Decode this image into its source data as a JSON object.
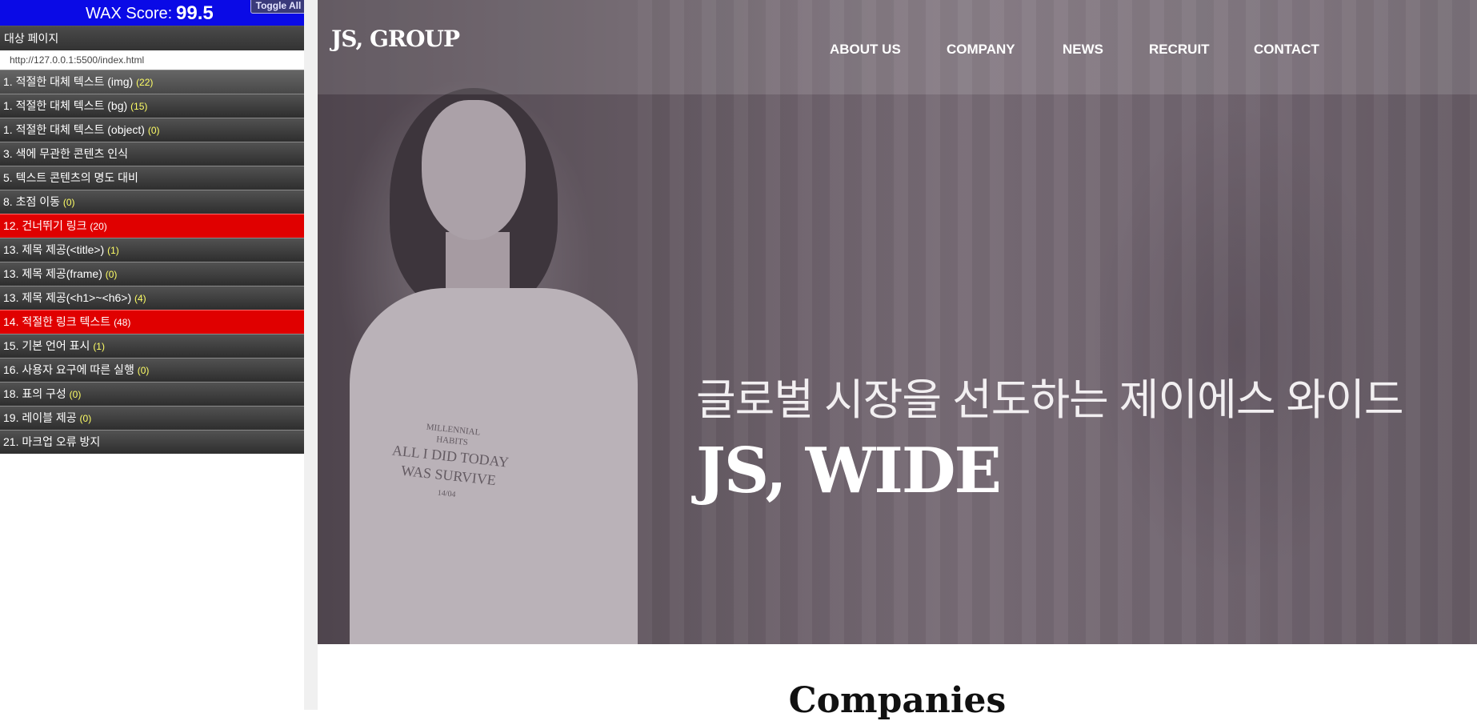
{
  "wax": {
    "score_label": "WAX Score:",
    "score_value": "99.5",
    "toggle_label": "Toggle All",
    "target_title": "대상 페이지",
    "target_url": "http://127.0.0.1:5500/index.html",
    "items": [
      {
        "label": "1. 적절한 대체 텍스트 (img)",
        "count": "(22)",
        "status": "normal"
      },
      {
        "label": "1. 적절한 대체 텍스트 (bg)",
        "count": "(15)",
        "status": "normal"
      },
      {
        "label": "1. 적절한 대체 텍스트 (object)",
        "count": "(0)",
        "status": "normal"
      },
      {
        "label": "3. 색에 무관한 콘텐츠 인식",
        "count": "",
        "status": "normal"
      },
      {
        "label": "5. 텍스트 콘텐츠의 명도 대비",
        "count": "",
        "status": "normal"
      },
      {
        "label": "8. 초점 이동",
        "count": "(0)",
        "status": "normal"
      },
      {
        "label": "12. 건너뛰기 링크",
        "count": "(20)",
        "status": "fail"
      },
      {
        "label": "13. 제목 제공(<title>)",
        "count": "(1)",
        "status": "normal"
      },
      {
        "label": "13. 제목 제공(frame)",
        "count": "(0)",
        "status": "normal"
      },
      {
        "label": "13. 제목 제공(<h1>~<h6>)",
        "count": "(4)",
        "status": "normal"
      },
      {
        "label": "14. 적절한 링크 텍스트",
        "count": "(48)",
        "status": "fail"
      },
      {
        "label": "15. 기본 언어 표시",
        "count": "(1)",
        "status": "normal"
      },
      {
        "label": "16. 사용자 요구에 따른 실행",
        "count": "(0)",
        "status": "normal"
      },
      {
        "label": "18. 표의 구성",
        "count": "(0)",
        "status": "normal"
      },
      {
        "label": "19. 레이블 제공",
        "count": "(0)",
        "status": "normal"
      },
      {
        "label": "21. 마크업 오류 방지",
        "count": "",
        "status": "normal"
      }
    ],
    "colors": {
      "header": "#0a0ae6",
      "fail": "#e00000",
      "count": "#ffff66"
    }
  },
  "site": {
    "logo": "JS, GROUP",
    "nav": [
      "ABOUT US",
      "COMPANY",
      "NEWS",
      "RECRUIT",
      "CONTACT"
    ],
    "hero_subtitle": "글로벌 시장을 선도하는 제이에스 와이드",
    "hero_title": "JS, WIDE",
    "shirt_print": [
      "MILLENNIAL",
      "HABITS",
      "ALL I DID TODAY",
      "WAS SURVIVE",
      "14/04"
    ],
    "section_heading": "Companies"
  }
}
